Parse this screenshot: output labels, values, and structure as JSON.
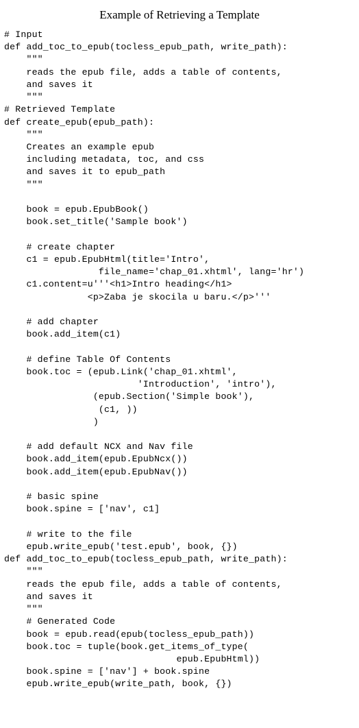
{
  "title": "Example of Retrieving a Template",
  "code": "# Input\ndef add_toc_to_epub(tocless_epub_path, write_path):\n    \"\"\"\n    reads the epub file, adds a table of contents,\n    and saves it\n    \"\"\"\n# Retrieved Template\ndef create_epub(epub_path):\n    \"\"\"\n    Creates an example epub\n    including metadata, toc, and css\n    and saves it to epub_path\n    \"\"\"\n\n    book = epub.EpubBook()\n    book.set_title('Sample book')\n\n    # create chapter\n    c1 = epub.EpubHtml(title='Intro',\n                 file_name='chap_01.xhtml', lang='hr')\n    c1.content=u'''<h1>Intro heading</h1>\n               <p>Zaba je skocila u baru.</p>'''\n\n    # add chapter\n    book.add_item(c1)\n\n    # define Table Of Contents\n    book.toc = (epub.Link('chap_01.xhtml',\n                        'Introduction', 'intro'),\n                (epub.Section('Simple book'),\n                 (c1, ))\n                )\n\n    # add default NCX and Nav file\n    book.add_item(epub.EpubNcx())\n    book.add_item(epub.EpubNav())\n\n    # basic spine\n    book.spine = ['nav', c1]\n\n    # write to the file\n    epub.write_epub('test.epub', book, {})\ndef add_toc_to_epub(tocless_epub_path, write_path):\n    \"\"\"\n    reads the epub file, adds a table of contents,\n    and saves it\n    \"\"\"\n    # Generated Code\n    book = epub.read(epub(tocless_epub_path))\n    book.toc = tuple(book.get_items_of_type(\n                               epub.EpubHtml))\n    book.spine = ['nav'] + book.spine\n    epub.write_epub(write_path, book, {})"
}
